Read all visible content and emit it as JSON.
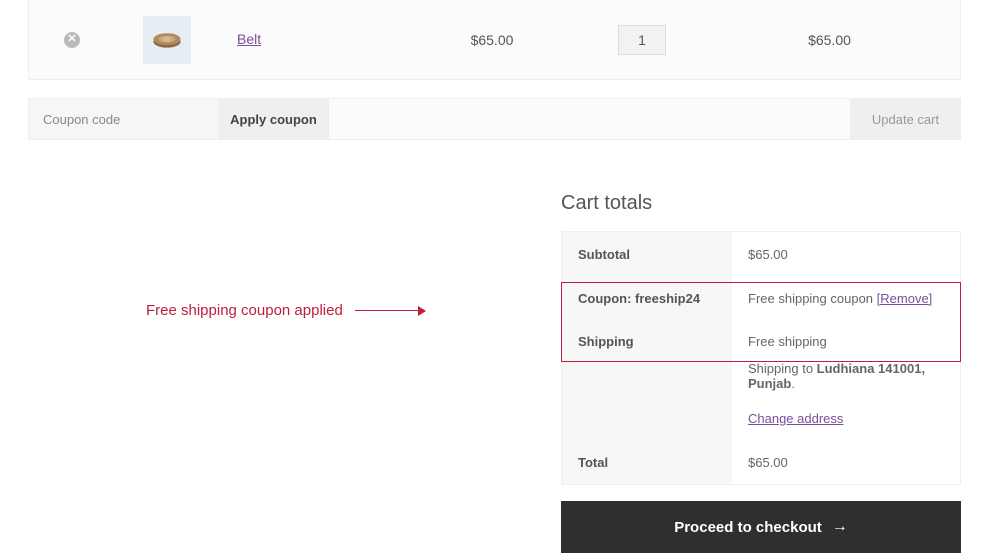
{
  "cart": {
    "items": [
      {
        "name": "Belt",
        "price": "$65.00",
        "quantity": "1",
        "subtotal": "$65.00"
      }
    ]
  },
  "coupon_bar": {
    "placeholder": "Coupon code",
    "apply_label": "Apply coupon",
    "update_label": "Update cart"
  },
  "annotation": {
    "text": "Free shipping coupon applied"
  },
  "totals": {
    "title": "Cart totals",
    "subtotal_label": "Subtotal",
    "subtotal_value": "$65.00",
    "coupon_label": "Coupon: freeship24",
    "coupon_value": "Free shipping coupon ",
    "remove_label": "[Remove]",
    "shipping_label": "Shipping",
    "shipping_value": "Free shipping",
    "shipping_to_prefix": "Shipping to ",
    "shipping_to_dest": "Ludhiana 141001, Punjab",
    "shipping_to_suffix": ".",
    "change_address": "Change address",
    "total_label": "Total",
    "total_value": "$65.00"
  },
  "checkout": {
    "label": "Proceed to checkout"
  }
}
